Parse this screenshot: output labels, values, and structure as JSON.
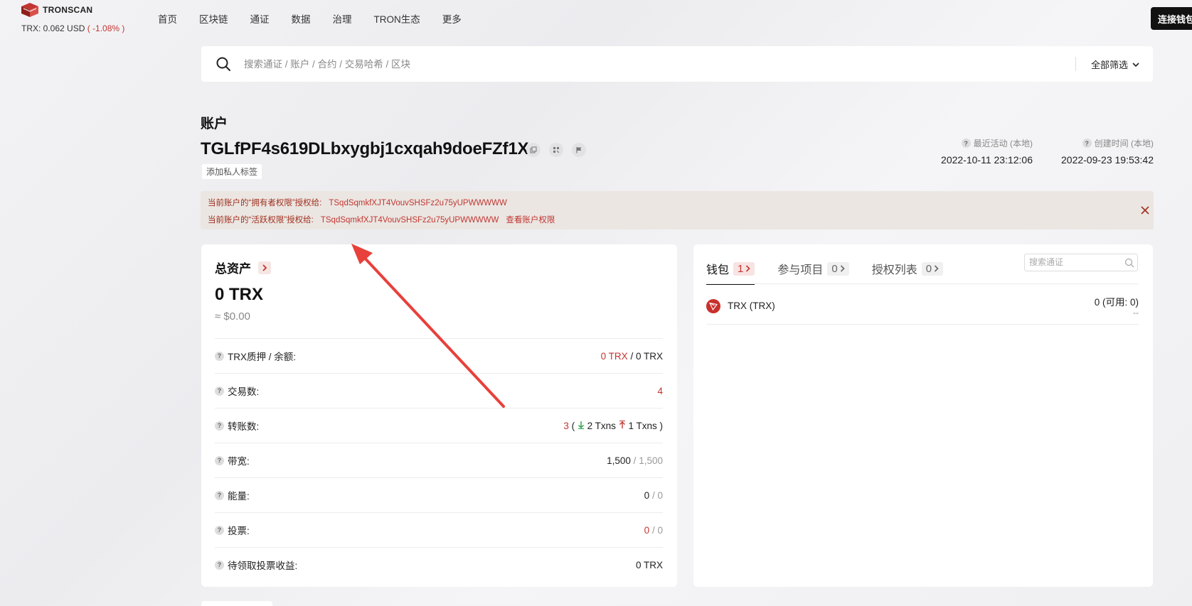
{
  "header": {
    "logo_text": "TRONSCAN",
    "price_label": "TRX: 0.062 USD",
    "price_change": "( -1.08% )",
    "nav": [
      "首页",
      "区块链",
      "通证",
      "数据",
      "治理",
      "TRON生态",
      "更多"
    ],
    "connect_wallet": "连接钱包"
  },
  "search": {
    "placeholder": "搜索通证 / 账户 / 合约 / 交易哈希 / 区块",
    "filter_label": "全部筛选"
  },
  "account": {
    "title": "账户",
    "address": "TGLfPF4s619DLbxygbj1cxqah9doeFZf1X",
    "add_tag": "添加私人标签",
    "last_active_label": "最近活动 (本地)",
    "last_active_value": "2022-10-11 23:12:06",
    "created_label": "创建时间 (本地)",
    "created_value": "2022-09-23 19:53:42"
  },
  "notice": {
    "owner_text": "当前账户的“拥有者权限”授权给:",
    "owner_addr": "TSqdSqmkfXJT4VouvSHSFz2u75yUPWWWWW",
    "active_text": "当前账户的“活跃权限”授权给:",
    "active_addr": "TSqdSqmkfXJT4VouvSHSFz2u75yUPWWWWW",
    "view_link": "查看账户权限"
  },
  "assets": {
    "title": "总资产",
    "total": "0 TRX",
    "usd": "≈ $0.00",
    "rows": [
      {
        "label": "TRX质押 / 余额:",
        "v1": "0 TRX",
        "sep": "/",
        "v2": "0 TRX"
      },
      {
        "label": "交易数:",
        "v1": "4"
      },
      {
        "label": "转账数:",
        "v1": "3",
        "open": "(",
        "in": "2 Txns",
        "out": "1 Txns",
        "close": ")"
      },
      {
        "label": "带宽:",
        "v1": "1,500",
        "sep": "/",
        "v2": "1,500"
      },
      {
        "label": "能量:",
        "v1": "0",
        "sep": "/",
        "v2": "0"
      },
      {
        "label": "投票:",
        "v1": "0",
        "sep": "/",
        "v2": "0"
      },
      {
        "label": "待领取投票收益:",
        "v1": "0 TRX"
      }
    ]
  },
  "wallet": {
    "tabs": [
      {
        "label": "钱包",
        "count": "1"
      },
      {
        "label": "参与项目",
        "count": "0"
      },
      {
        "label": "授权列表",
        "count": "0"
      }
    ],
    "search_placeholder": "搜索通证",
    "tokens": [
      {
        "name": "TRX (TRX)",
        "balance": "0 (可用: 0)",
        "usd": "--"
      }
    ]
  },
  "colors": {
    "accent_red": "#c23631",
    "dark": "#111111"
  }
}
